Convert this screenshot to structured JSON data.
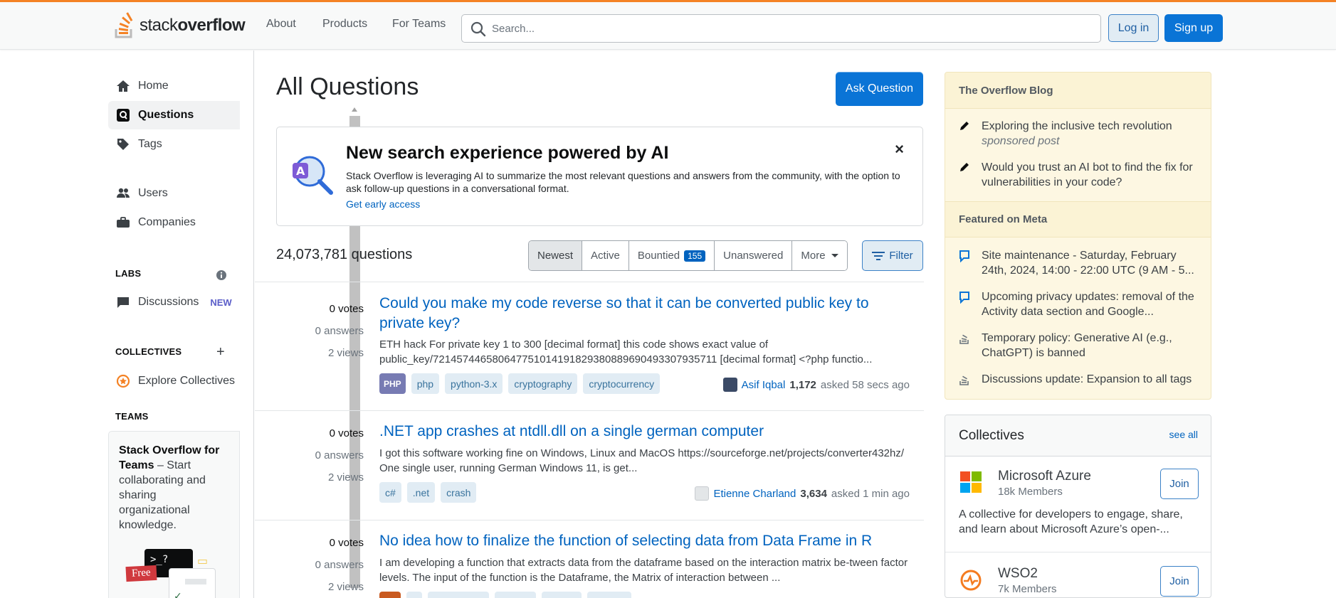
{
  "header": {
    "logo_text_light": "stack",
    "logo_text_bold": "overflow",
    "nav": [
      "About",
      "Products",
      "For Teams"
    ],
    "search_placeholder": "Search...",
    "login_label": "Log in",
    "signup_label": "Sign up",
    "brand_color": "#f48225"
  },
  "sidebar": {
    "items": [
      {
        "label": "Home",
        "icon": "home-icon"
      },
      {
        "label": "Questions",
        "icon": "questions-icon",
        "active": true
      },
      {
        "label": "Tags",
        "icon": "tag-icon"
      },
      {
        "label": "Users",
        "icon": "users-icon"
      },
      {
        "label": "Companies",
        "icon": "briefcase-icon"
      }
    ],
    "labs_title": "LABS",
    "discussions_label": "Discussions",
    "discussions_badge": "NEW",
    "collectives_title": "COLLECTIVES",
    "explore_collectives": "Explore Collectives",
    "teams_title": "TEAMS",
    "teams_heading": "Stack Overflow for Teams",
    "teams_text": " – Start collaborating and sharing organizational knowledge.",
    "free_label": "Free",
    "terminal_text": ">_?"
  },
  "main": {
    "title": "All Questions",
    "ask_button": "Ask Question",
    "banner": {
      "heading": "New search experience powered by AI",
      "description": "Stack Overflow is leveraging AI to summarize the most relevant questions and answers from the community, with the option to ask follow-up questions in a conversational format.",
      "link": "Get early access",
      "close": "×"
    },
    "question_count": "24,073,781 questions",
    "tabs": [
      {
        "label": "Newest",
        "selected": true
      },
      {
        "label": "Active"
      },
      {
        "label": "Bountied",
        "count": "155"
      },
      {
        "label": "Unanswered"
      },
      {
        "label": "More"
      }
    ],
    "filter_label": "Filter",
    "questions": [
      {
        "votes": "0 votes",
        "answers": "0 answers",
        "views": "2 views",
        "title": "Could you make my code reverse so that it can be converted public key to private key?",
        "excerpt": "ETH hack For private key 1 to 300 [decimal format] this code shows exact value of public_key/721457446580647751014191829380889690493307935711 [decimal format] <?php functio...",
        "tags": [
          "PHP",
          "php",
          "python-3.x",
          "cryptography",
          "cryptocurrency"
        ],
        "user": "Asif Iqbal",
        "rep": "1,172",
        "time": "asked 58 secs ago"
      },
      {
        "votes": "0 votes",
        "answers": "0 answers",
        "views": "2 views",
        "title": ".NET app crashes at ntdll.dll on a single german computer",
        "excerpt": "I got this software working fine on Windows, Linux and MacOS https://sourceforge.net/projects/converter432hz/ One single user, running German Windows 11, is get...",
        "tags": [
          "c#",
          ".net",
          "crash"
        ],
        "user": "Etienne Charland",
        "rep": "3,634",
        "time": "asked 1 min ago"
      },
      {
        "votes": "0 votes",
        "answers": "0 answers",
        "views": "2 views",
        "title": "No idea how to finalize the function of selecting data from Data Frame in R",
        "excerpt": "I am developing a function that extracts data from the dataframe based on the interaction matrix be-tween factor levels. The input of the function is the Dataframe, the Matrix of interaction between ...",
        "tags": [],
        "user": "",
        "rep": "",
        "time": ""
      }
    ]
  },
  "right": {
    "blog_title": "The Overflow Blog",
    "blog_items": [
      {
        "text": "Exploring the inclusive tech revolution",
        "sub": "sponsored post"
      },
      {
        "text": "Would you trust an AI bot to find the fix for vulnerabilities in your code?"
      }
    ],
    "meta_title": "Featured on Meta",
    "meta_items": [
      {
        "text": "Site maintenance - Saturday, February 24th, 2024, 14:00 - 22:00 UTC (9 AM - 5...",
        "icon": "chat-icon"
      },
      {
        "text": "Upcoming privacy updates: removal of the Activity data section and Google...",
        "icon": "chat-icon"
      },
      {
        "text": "Temporary policy: Generative AI (e.g., ChatGPT) is banned",
        "icon": "stack-icon"
      },
      {
        "text": "Discussions update: Expansion to all tags",
        "icon": "stack-icon"
      }
    ],
    "collectives_title": "Collectives",
    "see_all": "see all",
    "collectives": [
      {
        "name": "Microsoft Azure",
        "members": "18k Members",
        "join": "Join",
        "desc": "A collective for developers to engage, share, and learn about Microsoft Azure’s open-..."
      },
      {
        "name": "WSO2",
        "members": "7k Members",
        "join": "Join",
        "desc": ""
      }
    ]
  }
}
